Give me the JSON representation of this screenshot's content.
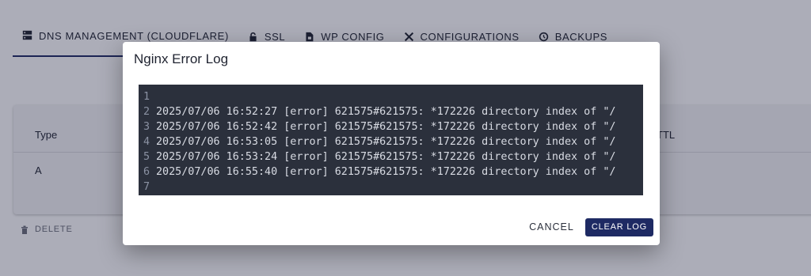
{
  "tabs": [
    {
      "label": "DNS MANAGEMENT (CLOUDFLARE)",
      "icon": "dns-icon"
    },
    {
      "label": "SSL",
      "icon": "lock-icon"
    },
    {
      "label": "WP CONFIG",
      "icon": "file-lock-icon"
    },
    {
      "label": "CONFIGURATIONS",
      "icon": "tools-icon"
    },
    {
      "label": "BACKUPS",
      "icon": "history-icon"
    }
  ],
  "table": {
    "headers": {
      "type": "Type",
      "ttl": "TTL"
    },
    "rows": [
      {
        "type": "A",
        "ttl_partial": "-"
      }
    ]
  },
  "delete_label": "DELETE",
  "dialog": {
    "title": "Nginx Error Log",
    "log_lines": [
      {
        "n": "1",
        "text": ""
      },
      {
        "n": "2",
        "text": "2025/07/06 16:52:27 [error] 621575#621575: *172226 directory index of \"/"
      },
      {
        "n": "3",
        "text": "2025/07/06 16:52:42 [error] 621575#621575: *172226 directory index of \"/"
      },
      {
        "n": "4",
        "text": "2025/07/06 16:53:05 [error] 621575#621575: *172226 directory index of \"/"
      },
      {
        "n": "5",
        "text": "2025/07/06 16:53:24 [error] 621575#621575: *172226 directory index of \"/"
      },
      {
        "n": "6",
        "text": "2025/07/06 16:55:40 [error] 621575#621575: *172226 directory index of \"/"
      },
      {
        "n": "7",
        "text": ""
      }
    ],
    "cancel_label": "CANCEL",
    "clear_label": "CLEAR LOG"
  },
  "colors": {
    "accent": "#1e2a63",
    "code_bg": "#2b303c"
  }
}
